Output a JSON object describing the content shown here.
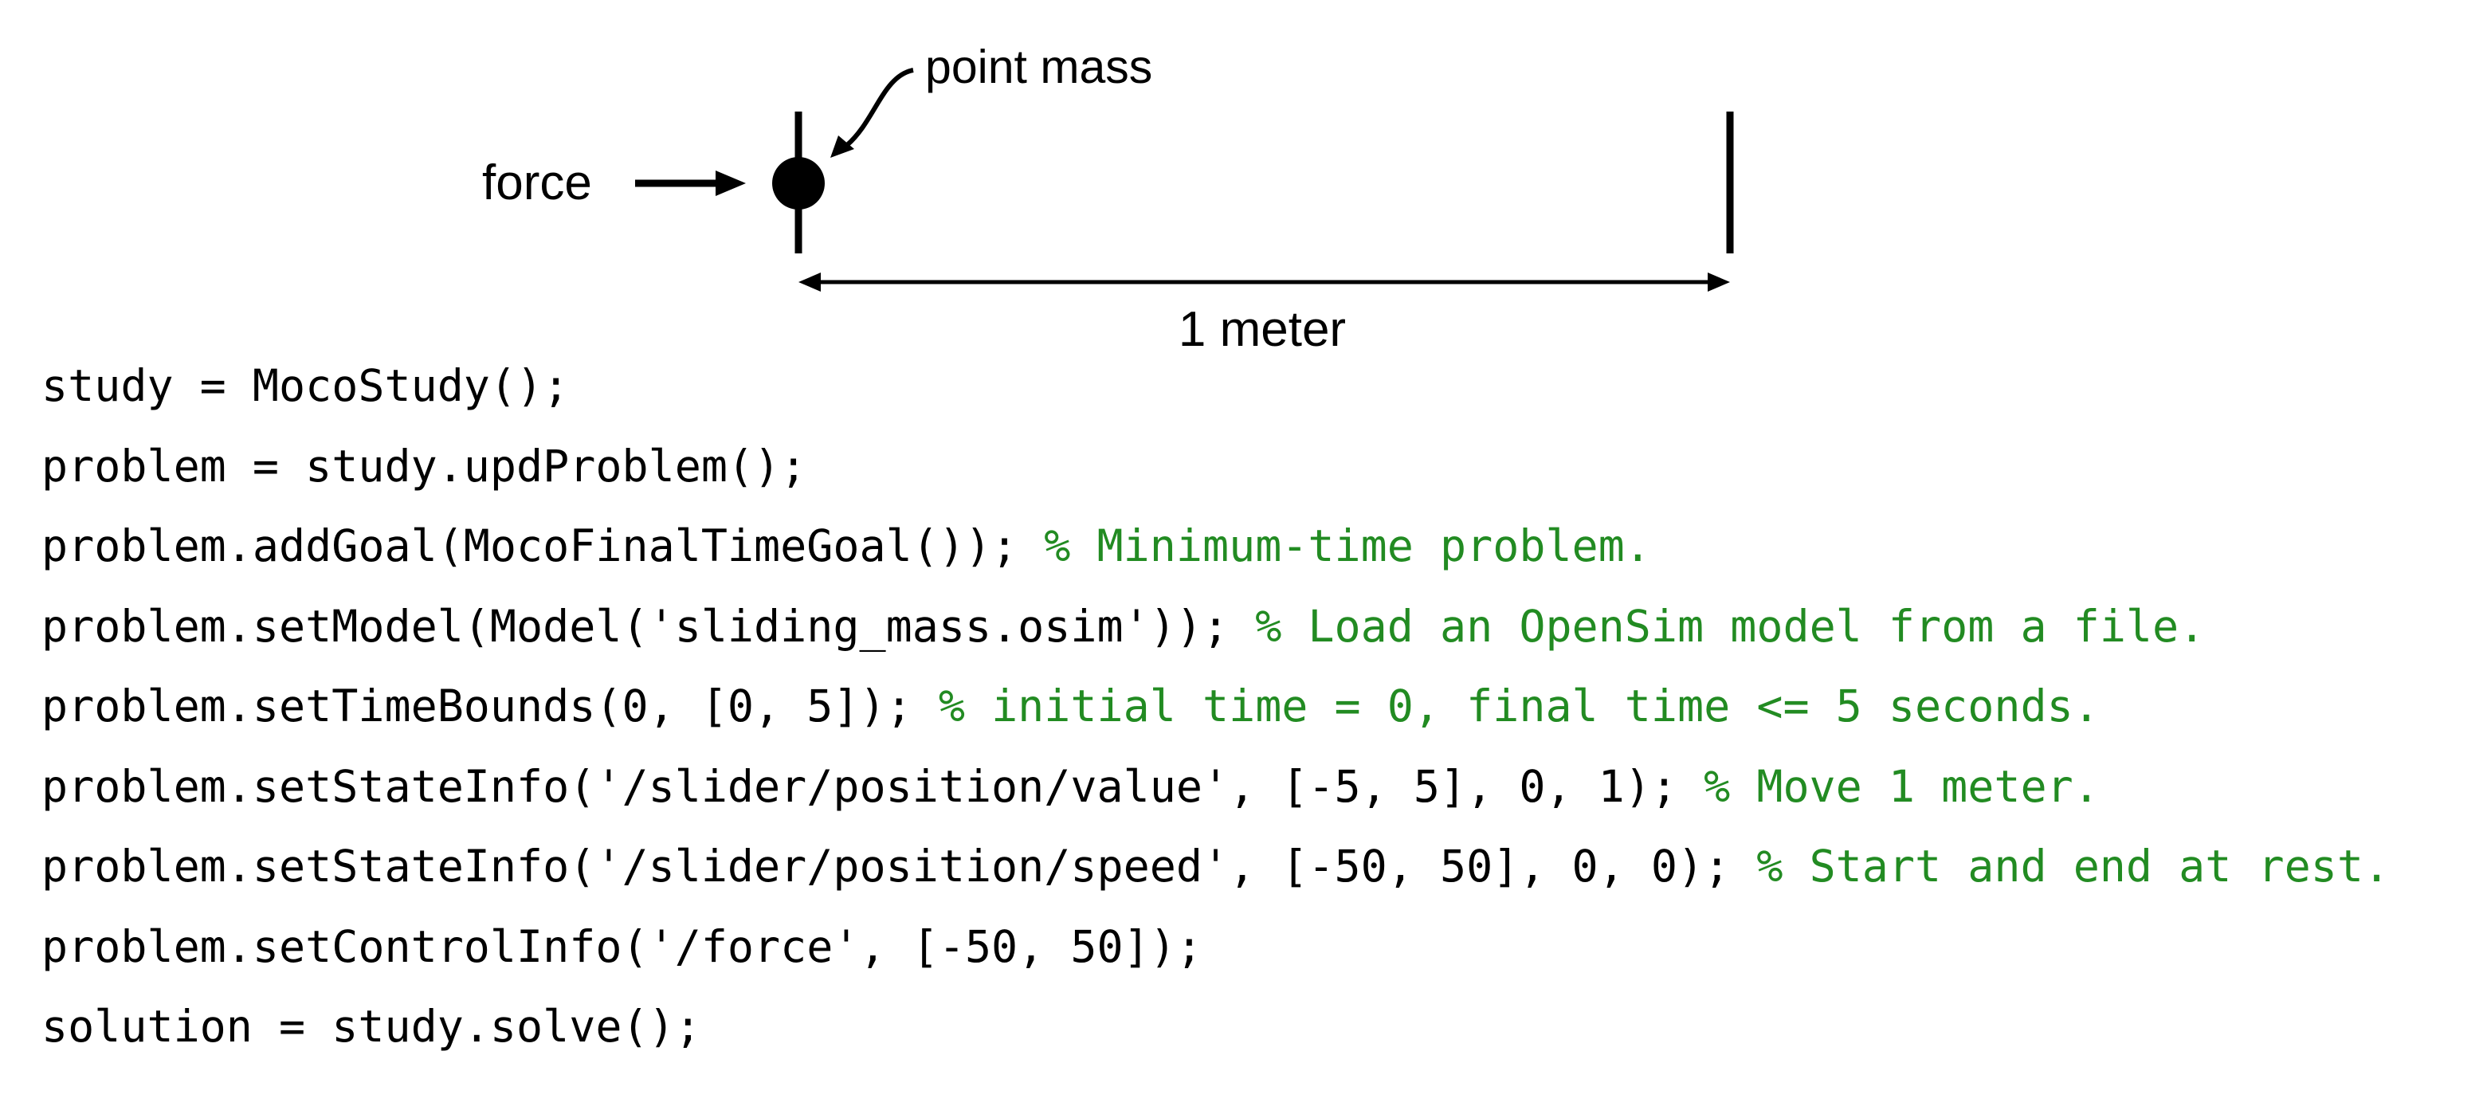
{
  "diagram": {
    "label_point_mass": "point mass",
    "label_force": "force",
    "label_distance": "1 meter"
  },
  "code": {
    "comment_color": "#228b22",
    "lines": [
      {
        "code": "study = MocoStudy();",
        "comment": ""
      },
      {
        "code": "problem = study.updProblem();",
        "comment": ""
      },
      {
        "code": "problem.addGoal(MocoFinalTimeGoal()); ",
        "comment": "% Minimum-time problem."
      },
      {
        "code": "problem.setModel(Model('sliding_mass.osim')); ",
        "comment": "% Load an OpenSim model from a file."
      },
      {
        "code": "problem.setTimeBounds(0, [0, 5]); ",
        "comment": "% initial time = 0, final time <= 5 seconds."
      },
      {
        "code": "problem.setStateInfo('/slider/position/value', [-5, 5], 0, 1); ",
        "comment": "% Move 1 meter."
      },
      {
        "code": "problem.setStateInfo('/slider/position/speed', [-50, 50], 0, 0); ",
        "comment": "% Start and end at rest."
      },
      {
        "code": "problem.setControlInfo('/force', [-50, 50]);",
        "comment": ""
      },
      {
        "code": "solution = study.solve();",
        "comment": ""
      }
    ]
  }
}
